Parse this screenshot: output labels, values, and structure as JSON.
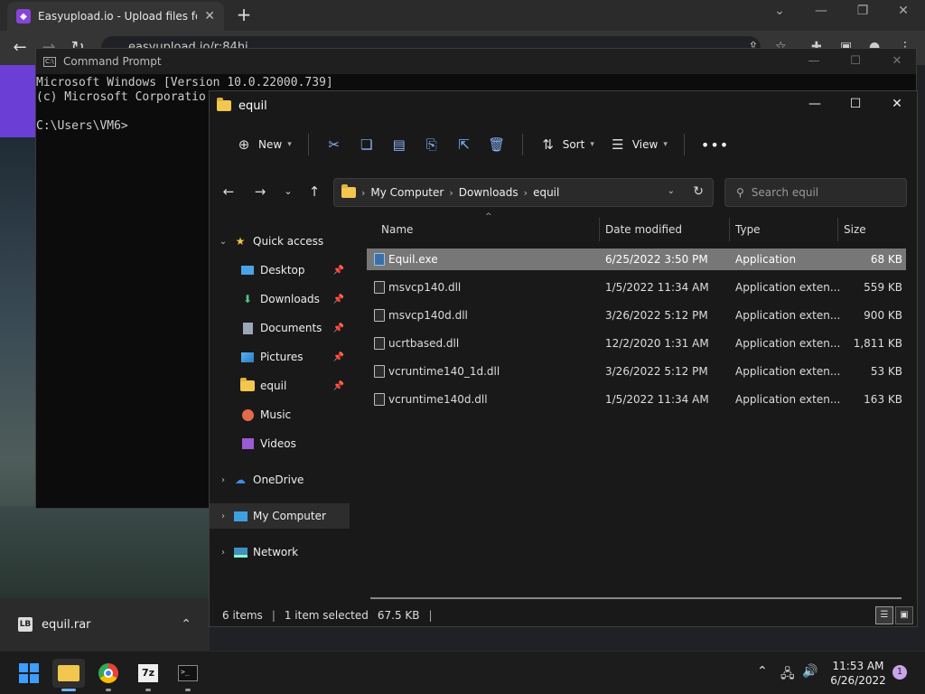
{
  "browser": {
    "tab_title": "Easyupload.io - Upload files for f",
    "url": "easyupload.io/r:84hi"
  },
  "cmd": {
    "title": "Command Prompt",
    "lines": [
      "Microsoft Windows [Version 10.0.22000.739]",
      "(c) Microsoft Corporatio",
      "",
      "C:\\Users\\VM6>"
    ]
  },
  "explorer": {
    "title": "equil",
    "toolbar": {
      "new_label": "New",
      "sort_label": "Sort",
      "view_label": "View"
    },
    "breadcrumbs": [
      "My Computer",
      "Downloads",
      "equil"
    ],
    "search_placeholder": "Search equil",
    "nav": {
      "quick_access": "Quick access",
      "items": [
        {
          "label": "Desktop",
          "icon": "desktop-icon"
        },
        {
          "label": "Downloads",
          "icon": "download-icon"
        },
        {
          "label": "Documents",
          "icon": "document-icon"
        },
        {
          "label": "Pictures",
          "icon": "pictures-icon"
        },
        {
          "label": "equil",
          "icon": "folder-icon"
        },
        {
          "label": "Music",
          "icon": "music-icon"
        },
        {
          "label": "Videos",
          "icon": "videos-icon"
        }
      ],
      "onedrive": "OneDrive",
      "mycomputer": "My Computer",
      "network": "Network"
    },
    "columns": {
      "name": "Name",
      "date": "Date modified",
      "type": "Type",
      "size": "Size"
    },
    "files": [
      {
        "name": "Equil.exe",
        "date": "6/25/2022 3:50 PM",
        "type": "Application",
        "size": "68 KB"
      },
      {
        "name": "msvcp140.dll",
        "date": "1/5/2022 11:34 AM",
        "type": "Application exten...",
        "size": "559 KB"
      },
      {
        "name": "msvcp140d.dll",
        "date": "3/26/2022 5:12 PM",
        "type": "Application exten...",
        "size": "900 KB"
      },
      {
        "name": "ucrtbased.dll",
        "date": "12/2/2020 1:31 AM",
        "type": "Application exten...",
        "size": "1,811 KB"
      },
      {
        "name": "vcruntime140_1d.dll",
        "date": "3/26/2022 5:12 PM",
        "type": "Application exten...",
        "size": "53 KB"
      },
      {
        "name": "vcruntime140d.dll",
        "date": "1/5/2022 11:34 AM",
        "type": "Application exten...",
        "size": "163 KB"
      }
    ],
    "status": {
      "items": "6 items",
      "selected": "1 item selected",
      "size": "67.5 KB"
    }
  },
  "download_shelf": {
    "file": "equil.rar"
  },
  "taskbar": {
    "time": "11:53 AM",
    "date": "6/26/2022",
    "notifications": "1"
  }
}
